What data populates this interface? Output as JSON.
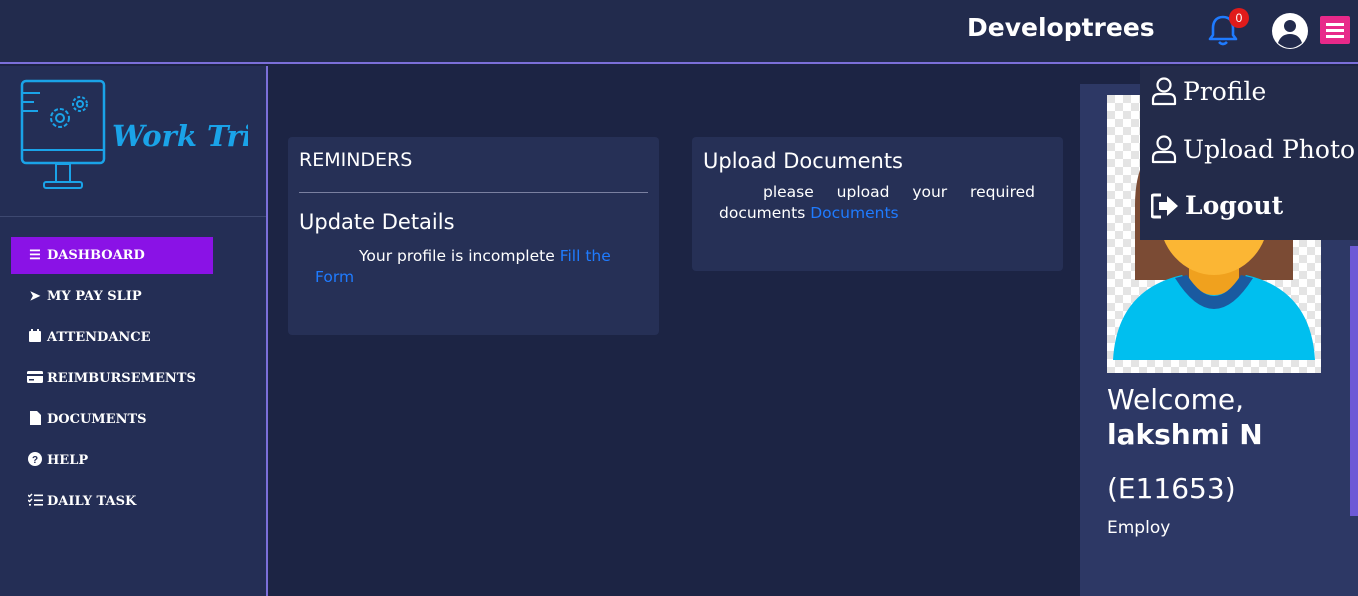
{
  "header": {
    "brand": "Developtrees",
    "notification_count": "0"
  },
  "sidebar": {
    "logo_text": "Work Tried",
    "items": [
      {
        "label": "DASHBOARD",
        "icon": "bars-icon",
        "active": true
      },
      {
        "label": "MY PAY SLIP",
        "icon": "paper-plane-icon",
        "active": false
      },
      {
        "label": "ATTENDANCE",
        "icon": "calendar-icon",
        "active": false
      },
      {
        "label": "REIMBURSEMENTS",
        "icon": "credit-card-icon",
        "active": false
      },
      {
        "label": "DOCUMENTS",
        "icon": "file-icon",
        "active": false
      },
      {
        "label": "HELP",
        "icon": "question-circle-icon",
        "active": false
      },
      {
        "label": "DAILY TASK",
        "icon": "tasks-icon",
        "active": false
      }
    ]
  },
  "reminders": {
    "title": "REMINDERS",
    "subtitle": "Update Details",
    "message": "Your profile is incomplete",
    "link": "Fill the Form"
  },
  "upload": {
    "title": "Upload Documents",
    "message": "please upload your required documents",
    "link": "Documents"
  },
  "profile": {
    "welcome": "Welcome,",
    "name": "lakshmi N",
    "code": "(E11653)",
    "role": "Employ"
  },
  "dropdown": {
    "profile": "Profile",
    "upload_photo": "Upload Photo",
    "logout": "Logout"
  },
  "colors": {
    "accent_purple": "#8a12e6",
    "link_blue": "#1f7bff",
    "badge_red": "#e01b1b",
    "menu_pink": "#e8298a",
    "logo_blue": "#1aa3e8"
  }
}
